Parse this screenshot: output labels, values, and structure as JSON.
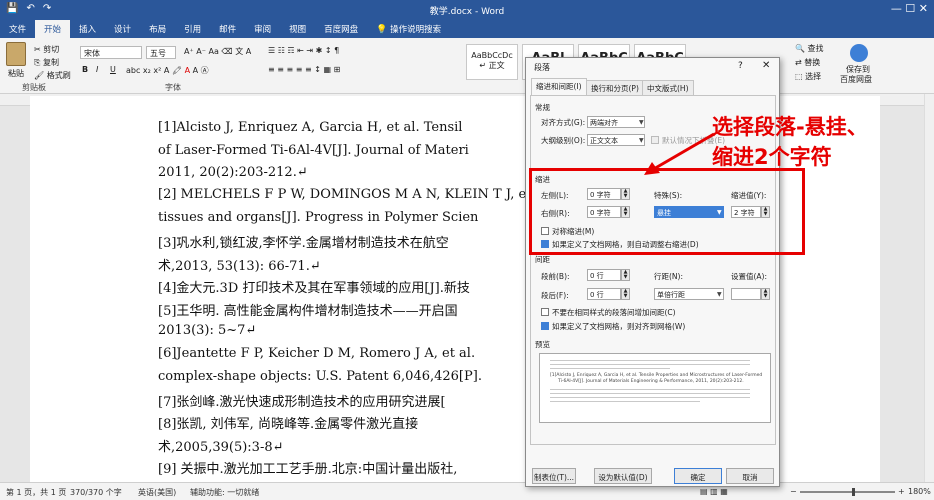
{
  "window": {
    "title": "教学.docx  -  Word",
    "quick_access": [
      "💾",
      "↶",
      "↷"
    ],
    "controls": "—  ☐  ✕"
  },
  "tabs": [
    "文件",
    "开始",
    "插入",
    "设计",
    "布局",
    "引用",
    "邮件",
    "审阅",
    "视图",
    "百度网盘",
    "操作说明搜索"
  ],
  "ribbon": {
    "clipboard": {
      "paste": "粘贴",
      "cut": "剪切",
      "copy": "复制",
      "format_painter": "格式刷",
      "label": "剪贴板"
    },
    "font": {
      "name": "宋体",
      "size": "五号",
      "label": "字体",
      "bold": "B",
      "italic": "I",
      "underline": "U"
    },
    "styles": [
      {
        "sample": "AaBbCcDc",
        "name": "↵ 正文"
      },
      {
        "sample": "AaBl",
        "name": ""
      },
      {
        "sample": "AaBbC",
        "name": ""
      },
      {
        "sample": "AaBbC",
        "name": ""
      }
    ],
    "editing": {
      "find": "查找",
      "replace": "替换",
      "select": "选择"
    },
    "save": {
      "line1": "保存到",
      "line2": "百度网盘"
    }
  },
  "document": {
    "lines": [
      "[1]Alcisto J, Enriquez A, Garcia H, et al. Tensil",
      "of Laser-Formed Ti-6Al-4V[J]. Journal of Materi",
      "2011, 20(2):203-212.↵",
      "[2] MELCHELS F P W, DOMINGOS M A N, KLEIN T J, e",
      "tissues and organs[J]. Progress in Polymer Scien",
      "[3]巩水利,锁红波,李怀学.金属增材制造技术在航空",
      "术,2013, 53(13): 66-71.↵",
      "[4]金大元.3D 打印技术及其在军事领域的应用[J].新技",
      "[5]王华明. 高性能金属构件增材制造技术——开启国",
      "2013(3): 5~7↵",
      "[6]Jeantette F P, Keicher D M, Romero J A, et al.",
      "complex-shape objects: U.S. Patent 6,046,426[P].",
      "[7]张剑峰.激光快速成形制造技术的应用研究进展[",
      "[8]张凯, 刘伟军, 尚晓峰等.金属零件激光直接",
      "术,2005,39(5):3-8↵",
      "[9] 关振中.激光加工工艺手册.北京:中国计量出版社,"
    ]
  },
  "dialog": {
    "title": "段落",
    "help": "?",
    "close": "✕",
    "tabs": [
      "缩进和间距(I)",
      "换行和分页(P)",
      "中文版式(H)"
    ],
    "general": {
      "section": "常规",
      "alignment_label": "对齐方式(G):",
      "alignment_value": "两端对齐",
      "outline_label": "大纲级别(O):",
      "outline_value": "正文文本",
      "collapsed_label": "默认情况下折叠(E)"
    },
    "indent": {
      "section": "缩进",
      "left_label": "左侧(L):",
      "left_value": "0 字符",
      "right_label": "右侧(R):",
      "right_value": "0 字符",
      "special_label": "特殊(S):",
      "special_value": "悬挂",
      "by_label": "缩进值(Y):",
      "by_value": "2 字符",
      "mirror_label": "对称缩进(M)",
      "grid_label": "如果定义了文档网格，则自动调整右缩进(D)"
    },
    "spacing": {
      "section": "间距",
      "before_label": "段前(B):",
      "before_value": "0 行",
      "after_label": "段后(F):",
      "after_value": "0 行",
      "line_label": "行距(N):",
      "line_value": "单倍行距",
      "at_label": "设置值(A):",
      "at_value": "",
      "no_space_label": "不要在相同样式的段落间增加间距(C)",
      "snap_label": "如果定义了文档网格，则对齐到网格(W)"
    },
    "preview": {
      "section": "预览",
      "text": [
        "[1]Alcisto J, Enriquez A, Garcia H, et al. Tensile Properties and Microstructures of Laser-Formed",
        "Ti-6Al-4V[J]. Journal of Materials Engineering & Performance, 2011, 20(2):203-212."
      ]
    },
    "buttons": {
      "tabs": "制表位(T)...",
      "default": "设为默认值(D)",
      "ok": "确定",
      "cancel": "取消"
    }
  },
  "annotation": {
    "line1": "选择段落-悬挂、",
    "line2": "缩进2个字符",
    "color": "#e60000"
  },
  "status": {
    "page": "第 1 页，共 1 页",
    "words": "370/370 个字",
    "lang": "英语(美国)",
    "access": "辅助功能: 一切就绪",
    "zoom": "180%"
  }
}
